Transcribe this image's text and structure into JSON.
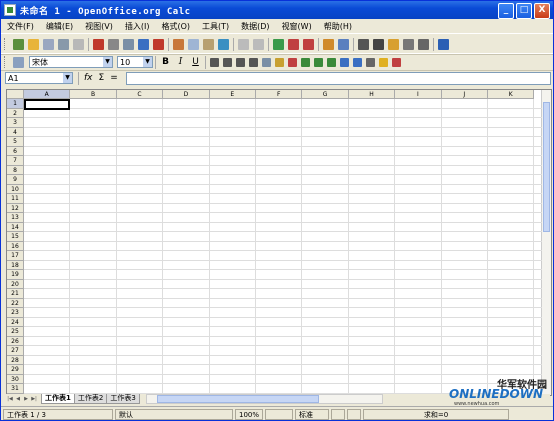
{
  "window": {
    "title": "未命名 1 - OpenOffice.org Calc",
    "btn_min": "_",
    "btn_max": "□",
    "btn_close": "X"
  },
  "menu": [
    "文件(F)",
    "编辑(E)",
    "视图(V)",
    "插入(I)",
    "格式(O)",
    "工具(T)",
    "数据(D)",
    "视窗(W)",
    "帮助(H)"
  ],
  "toolbar_icons": [
    {
      "name": "new-document-icon",
      "color": "#5b8f3c"
    },
    {
      "name": "open-folder-icon",
      "color": "#e8b43a"
    },
    {
      "name": "save-icon",
      "color": "#9aa7c0"
    },
    {
      "name": "email-icon",
      "color": "#8899aa"
    },
    {
      "name": "edit-file-icon",
      "color": "#b8b8b8"
    },
    {
      "name": "export-pdf-icon",
      "color": "#c0392b"
    },
    {
      "name": "print-icon",
      "color": "#888888"
    },
    {
      "name": "page-preview-icon",
      "color": "#7a8fa6"
    },
    {
      "name": "spellcheck-icon",
      "color": "#3a6fc2"
    },
    {
      "name": "autospell-icon",
      "color": "#c0392b"
    },
    {
      "name": "cut-icon",
      "color": "#c8783a"
    },
    {
      "name": "copy-icon",
      "color": "#9fb5d4"
    },
    {
      "name": "paste-icon",
      "color": "#b8a070"
    },
    {
      "name": "format-paintbrush-icon",
      "color": "#3a8fc2"
    },
    {
      "name": "undo-icon",
      "color": "#bbbbbb"
    },
    {
      "name": "redo-icon",
      "color": "#bbbbbb"
    },
    {
      "name": "hyperlink-icon",
      "color": "#3a9a4a"
    },
    {
      "name": "sort-ascending-icon",
      "color": "#c04040"
    },
    {
      "name": "sort-descending-icon",
      "color": "#c04040"
    },
    {
      "name": "insert-chart-icon",
      "color": "#d08a2a"
    },
    {
      "name": "show-draw-functions-icon",
      "color": "#5a7fbf"
    },
    {
      "name": "find-icon",
      "color": "#555555"
    },
    {
      "name": "navigator-icon",
      "color": "#444444"
    },
    {
      "name": "gallery-icon",
      "color": "#d8a030"
    },
    {
      "name": "datasources-icon",
      "color": "#777777"
    },
    {
      "name": "zoom-icon",
      "color": "#666666"
    },
    {
      "name": "help-icon",
      "color": "#2b5fb4"
    }
  ],
  "format_toolbar": {
    "font_name": "宋体",
    "font_size": "10",
    "bold": "B",
    "italic": "I",
    "underline": "U"
  },
  "format_icons": [
    "align-left-icon",
    "align-center-icon",
    "align-right-icon",
    "justify-icon",
    "merge-cells-icon",
    "currency-format-icon",
    "percent-format-icon",
    "standard-format-icon",
    "add-decimal-icon",
    "delete-decimal-icon",
    "decrease-indent-icon",
    "increase-indent-icon",
    "borders-icon",
    "background-color-icon",
    "font-color-icon"
  ],
  "formula_bar": {
    "name_box": "A1",
    "fx": "fx",
    "sum": "Σ",
    "equals": "="
  },
  "columns": [
    "A",
    "B",
    "C",
    "D",
    "E",
    "F",
    "G",
    "H",
    "I",
    "J",
    "K"
  ],
  "rows": [
    "1",
    "2",
    "3",
    "4",
    "5",
    "6",
    "7",
    "8",
    "9",
    "10",
    "11",
    "12",
    "13",
    "14",
    "15",
    "16",
    "17",
    "18",
    "19",
    "20",
    "21",
    "22",
    "23",
    "24",
    "25",
    "26",
    "27",
    "28",
    "29",
    "30",
    "31"
  ],
  "sheet_tabs": [
    "工作表1",
    "工作表2",
    "工作表3"
  ],
  "status": {
    "sheet": "工作表 1 / 3",
    "page_style": "默认",
    "zoom": "100%",
    "mode": "标准",
    "sum": "求和=0"
  },
  "watermark": {
    "line1": "华军软件园",
    "logo": "ONLINEDOWN",
    "url": "www.newhua.com"
  }
}
